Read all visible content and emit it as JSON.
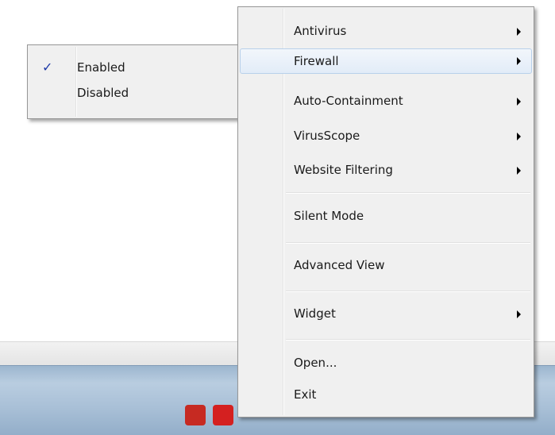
{
  "main_menu": {
    "items": [
      {
        "label": "Antivirus",
        "submenu": true
      },
      {
        "label": "Firewall",
        "submenu": true,
        "active": true
      },
      {
        "label": "Auto-Containment",
        "submenu": true
      },
      {
        "label": "VirusScope",
        "submenu": true
      },
      {
        "label": "Website Filtering",
        "submenu": true
      },
      {
        "label": "Silent Mode",
        "submenu": false
      },
      {
        "label": "Advanced View",
        "submenu": false
      },
      {
        "label": "Widget",
        "submenu": true
      },
      {
        "label": "Open...",
        "submenu": false
      },
      {
        "label": "Exit",
        "submenu": false
      }
    ]
  },
  "firewall_submenu": {
    "items": [
      {
        "label": "Enabled",
        "checked": true,
        "check_glyph": "✓"
      },
      {
        "label": "Disabled",
        "checked": false
      }
    ]
  },
  "colors": {
    "menu_bg": "#f0f0f0",
    "hover_border": "#b8d0ea",
    "check_color": "#1e3aa8",
    "taskbar": "#a9c0d7"
  },
  "icons": {
    "submenu_arrow": "chevron-right-icon",
    "check": "check-icon"
  }
}
